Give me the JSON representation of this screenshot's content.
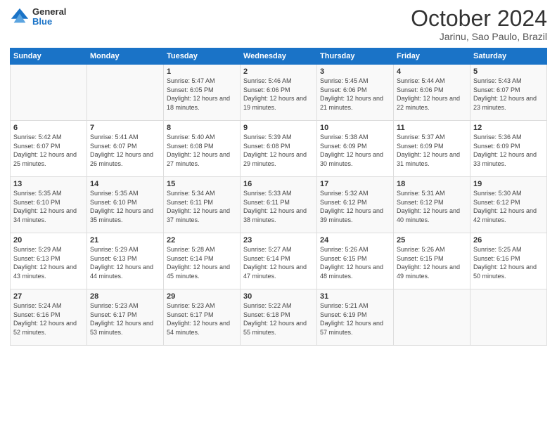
{
  "header": {
    "logo_general": "General",
    "logo_blue": "Blue",
    "title": "October 2024",
    "subtitle": "Jarinu, Sao Paulo, Brazil"
  },
  "days_of_week": [
    "Sunday",
    "Monday",
    "Tuesday",
    "Wednesday",
    "Thursday",
    "Friday",
    "Saturday"
  ],
  "weeks": [
    [
      {
        "day": "",
        "info": ""
      },
      {
        "day": "",
        "info": ""
      },
      {
        "day": "1",
        "info": "Sunrise: 5:47 AM\nSunset: 6:05 PM\nDaylight: 12 hours and 18 minutes."
      },
      {
        "day": "2",
        "info": "Sunrise: 5:46 AM\nSunset: 6:06 PM\nDaylight: 12 hours and 19 minutes."
      },
      {
        "day": "3",
        "info": "Sunrise: 5:45 AM\nSunset: 6:06 PM\nDaylight: 12 hours and 21 minutes."
      },
      {
        "day": "4",
        "info": "Sunrise: 5:44 AM\nSunset: 6:06 PM\nDaylight: 12 hours and 22 minutes."
      },
      {
        "day": "5",
        "info": "Sunrise: 5:43 AM\nSunset: 6:07 PM\nDaylight: 12 hours and 23 minutes."
      }
    ],
    [
      {
        "day": "6",
        "info": "Sunrise: 5:42 AM\nSunset: 6:07 PM\nDaylight: 12 hours and 25 minutes."
      },
      {
        "day": "7",
        "info": "Sunrise: 5:41 AM\nSunset: 6:07 PM\nDaylight: 12 hours and 26 minutes."
      },
      {
        "day": "8",
        "info": "Sunrise: 5:40 AM\nSunset: 6:08 PM\nDaylight: 12 hours and 27 minutes."
      },
      {
        "day": "9",
        "info": "Sunrise: 5:39 AM\nSunset: 6:08 PM\nDaylight: 12 hours and 29 minutes."
      },
      {
        "day": "10",
        "info": "Sunrise: 5:38 AM\nSunset: 6:09 PM\nDaylight: 12 hours and 30 minutes."
      },
      {
        "day": "11",
        "info": "Sunrise: 5:37 AM\nSunset: 6:09 PM\nDaylight: 12 hours and 31 minutes."
      },
      {
        "day": "12",
        "info": "Sunrise: 5:36 AM\nSunset: 6:09 PM\nDaylight: 12 hours and 33 minutes."
      }
    ],
    [
      {
        "day": "13",
        "info": "Sunrise: 5:35 AM\nSunset: 6:10 PM\nDaylight: 12 hours and 34 minutes."
      },
      {
        "day": "14",
        "info": "Sunrise: 5:35 AM\nSunset: 6:10 PM\nDaylight: 12 hours and 35 minutes."
      },
      {
        "day": "15",
        "info": "Sunrise: 5:34 AM\nSunset: 6:11 PM\nDaylight: 12 hours and 37 minutes."
      },
      {
        "day": "16",
        "info": "Sunrise: 5:33 AM\nSunset: 6:11 PM\nDaylight: 12 hours and 38 minutes."
      },
      {
        "day": "17",
        "info": "Sunrise: 5:32 AM\nSunset: 6:12 PM\nDaylight: 12 hours and 39 minutes."
      },
      {
        "day": "18",
        "info": "Sunrise: 5:31 AM\nSunset: 6:12 PM\nDaylight: 12 hours and 40 minutes."
      },
      {
        "day": "19",
        "info": "Sunrise: 5:30 AM\nSunset: 6:12 PM\nDaylight: 12 hours and 42 minutes."
      }
    ],
    [
      {
        "day": "20",
        "info": "Sunrise: 5:29 AM\nSunset: 6:13 PM\nDaylight: 12 hours and 43 minutes."
      },
      {
        "day": "21",
        "info": "Sunrise: 5:29 AM\nSunset: 6:13 PM\nDaylight: 12 hours and 44 minutes."
      },
      {
        "day": "22",
        "info": "Sunrise: 5:28 AM\nSunset: 6:14 PM\nDaylight: 12 hours and 45 minutes."
      },
      {
        "day": "23",
        "info": "Sunrise: 5:27 AM\nSunset: 6:14 PM\nDaylight: 12 hours and 47 minutes."
      },
      {
        "day": "24",
        "info": "Sunrise: 5:26 AM\nSunset: 6:15 PM\nDaylight: 12 hours and 48 minutes."
      },
      {
        "day": "25",
        "info": "Sunrise: 5:26 AM\nSunset: 6:15 PM\nDaylight: 12 hours and 49 minutes."
      },
      {
        "day": "26",
        "info": "Sunrise: 5:25 AM\nSunset: 6:16 PM\nDaylight: 12 hours and 50 minutes."
      }
    ],
    [
      {
        "day": "27",
        "info": "Sunrise: 5:24 AM\nSunset: 6:16 PM\nDaylight: 12 hours and 52 minutes."
      },
      {
        "day": "28",
        "info": "Sunrise: 5:23 AM\nSunset: 6:17 PM\nDaylight: 12 hours and 53 minutes."
      },
      {
        "day": "29",
        "info": "Sunrise: 5:23 AM\nSunset: 6:17 PM\nDaylight: 12 hours and 54 minutes."
      },
      {
        "day": "30",
        "info": "Sunrise: 5:22 AM\nSunset: 6:18 PM\nDaylight: 12 hours and 55 minutes."
      },
      {
        "day": "31",
        "info": "Sunrise: 5:21 AM\nSunset: 6:19 PM\nDaylight: 12 hours and 57 minutes."
      },
      {
        "day": "",
        "info": ""
      },
      {
        "day": "",
        "info": ""
      }
    ]
  ]
}
